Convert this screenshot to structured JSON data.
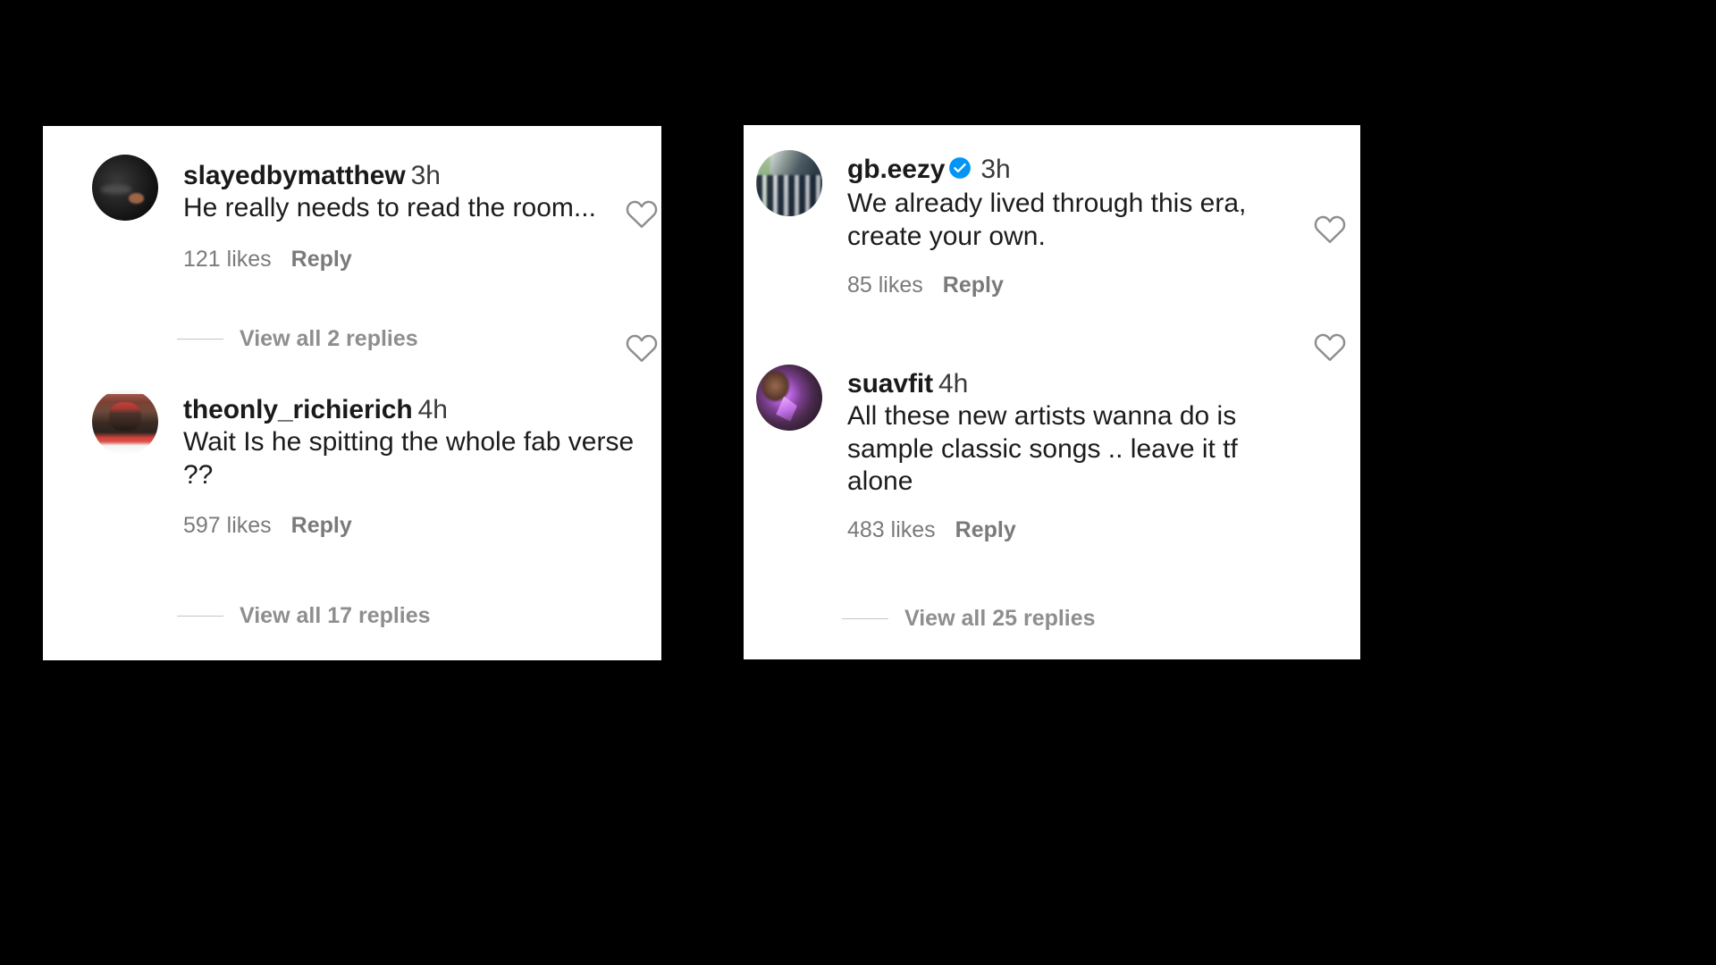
{
  "background_color": "#000000",
  "card_color": "#ffffff",
  "accent_verified_color": "#0095f6",
  "muted_text_color": "#8e8e8e",
  "panels": [
    {
      "id": "left",
      "comments": [
        {
          "username": "slayedbymatthew",
          "verified": false,
          "timestamp": "3h",
          "text": "He really needs to read the room...",
          "likes": "121 likes",
          "reply": "Reply",
          "view_replies": "View all 2 replies",
          "like_icon": "heart-outline-icon",
          "avatar": "avatar-dark-portrait"
        },
        {
          "username": "theonly_richierich",
          "verified": false,
          "timestamp": "4h",
          "text": "Wait Is he spitting the whole fab verse ??",
          "likes": "597 likes",
          "reply": "Reply",
          "view_replies": "View all 17 replies",
          "like_icon": "heart-outline-icon",
          "avatar": "avatar-brick-wall-red-hat"
        }
      ]
    },
    {
      "id": "right",
      "comments": [
        {
          "username": "gb.eezy",
          "verified": true,
          "timestamp": "3h",
          "text": "We already lived through this era, create your own.",
          "likes": "85 likes",
          "reply": "Reply",
          "view_replies": null,
          "like_icon": "heart-outline-icon",
          "avatar": "avatar-group-photo"
        },
        {
          "username": "suavfit",
          "verified": false,
          "timestamp": "4h",
          "text": "All these new artists wanna do is sample classic songs .. leave it tf alone",
          "likes": "483 likes",
          "reply": "Reply",
          "view_replies": "View all 25 replies",
          "like_icon": "heart-outline-icon",
          "avatar": "avatar-purple-portrait"
        }
      ]
    }
  ]
}
